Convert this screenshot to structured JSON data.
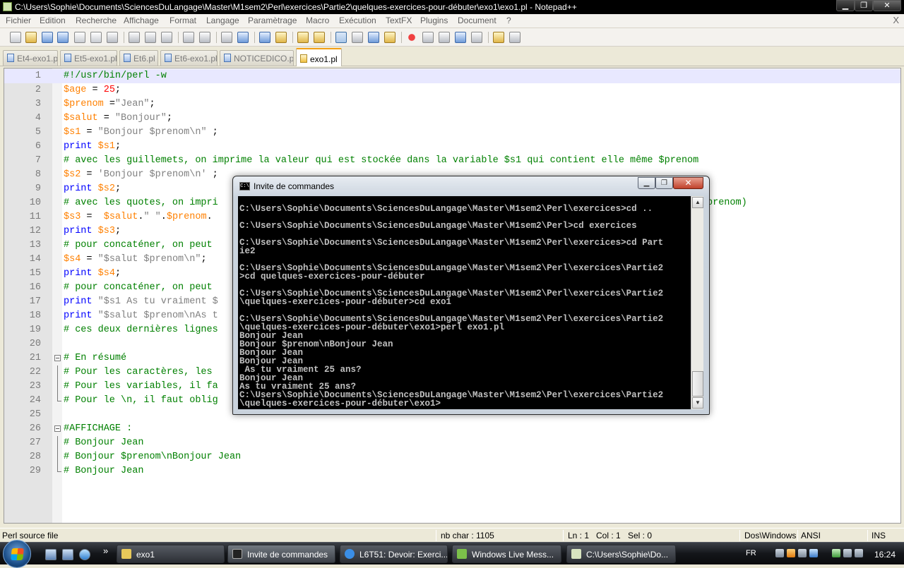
{
  "window": {
    "title": "C:\\Users\\Sophie\\Documents\\SciencesDuLangage\\Master\\M1sem2\\Perl\\exercices\\Partie2\\quelques-exercices-pour-débuter\\exo1\\exo1.pl - Notepad++",
    "minimize": "▁",
    "maximize": "❐",
    "close": "✕"
  },
  "menu": {
    "items": [
      "Fichier",
      "Edition",
      "Recherche",
      "Affichage",
      "Format",
      "Langage",
      "Paramètrage",
      "Macro",
      "Exécution",
      "TextFX",
      "Plugins",
      "Document",
      "?"
    ],
    "close_label": "X"
  },
  "tabs": [
    {
      "label": "Et4-exo1.pl",
      "active": false
    },
    {
      "label": "Et5-exo1.pl",
      "active": false
    },
    {
      "label": "Et6.pl",
      "active": false
    },
    {
      "label": "Et6-exo1.pl",
      "active": false
    },
    {
      "label": "NOTICEDICO.pl",
      "active": false
    },
    {
      "label": "exo1.pl",
      "active": true
    }
  ],
  "editor": {
    "current_line": 1,
    "lines": [
      {
        "n": "1",
        "tokens": [
          [
            "cm",
            "#!/usr/bin/perl -w"
          ]
        ]
      },
      {
        "n": "2",
        "tokens": [
          [
            "var",
            "$age"
          ],
          [
            "op",
            " = "
          ],
          [
            "num",
            "25"
          ],
          [
            "op",
            ";"
          ]
        ]
      },
      {
        "n": "3",
        "tokens": [
          [
            "var",
            "$prenom"
          ],
          [
            "op",
            " ="
          ],
          [
            "str",
            "\"Jean\""
          ],
          [
            "op",
            ";"
          ]
        ]
      },
      {
        "n": "4",
        "tokens": [
          [
            "var",
            "$salut"
          ],
          [
            "op",
            " = "
          ],
          [
            "str",
            "\"Bonjour\""
          ],
          [
            "op",
            ";"
          ]
        ]
      },
      {
        "n": "5",
        "tokens": [
          [
            "var",
            "$s1"
          ],
          [
            "op",
            " = "
          ],
          [
            "str",
            "\"Bonjour $prenom\\n\""
          ],
          [
            "op",
            " ;"
          ]
        ]
      },
      {
        "n": "6",
        "tokens": [
          [
            "kw",
            "print"
          ],
          [
            "op",
            " "
          ],
          [
            "var",
            "$s1"
          ],
          [
            "op",
            ";"
          ]
        ]
      },
      {
        "n": "7",
        "tokens": [
          [
            "cm",
            "# avec les guillemets, on imprime la valeur qui est stockée dans la variable $s1 qui contient elle même $prenom"
          ]
        ]
      },
      {
        "n": "8",
        "tokens": [
          [
            "var",
            "$s2"
          ],
          [
            "op",
            " = "
          ],
          [
            "str",
            "'Bonjour $prenom\\n'"
          ],
          [
            "op",
            " ;"
          ]
        ]
      },
      {
        "n": "9",
        "tokens": [
          [
            "kw",
            "print"
          ],
          [
            "op",
            " "
          ],
          [
            "var",
            "$s2"
          ],
          [
            "op",
            ";"
          ]
        ]
      },
      {
        "n": "10",
        "tokens": [
          [
            "cm",
            "# avec les quotes, on impri"
          ]
        ]
      },
      {
        "n": "11",
        "tokens": [
          [
            "var",
            "$s3"
          ],
          [
            "op",
            " =  "
          ],
          [
            "var",
            "$salut"
          ],
          [
            "op",
            "."
          ],
          [
            "str",
            "\" \""
          ],
          [
            "op",
            "."
          ],
          [
            "var",
            "$prenom"
          ],
          [
            "op",
            "."
          ]
        ]
      },
      {
        "n": "12",
        "tokens": [
          [
            "kw",
            "print"
          ],
          [
            "op",
            " "
          ],
          [
            "var",
            "$s3"
          ],
          [
            "op",
            ";"
          ]
        ]
      },
      {
        "n": "13",
        "tokens": [
          [
            "cm",
            "# pour concaténer, on peut "
          ]
        ]
      },
      {
        "n": "14",
        "tokens": [
          [
            "var",
            "$s4"
          ],
          [
            "op",
            " = "
          ],
          [
            "str",
            "\"$salut $prenom\\n\""
          ],
          [
            "op",
            ";"
          ]
        ]
      },
      {
        "n": "15",
        "tokens": [
          [
            "kw",
            "print"
          ],
          [
            "op",
            " "
          ],
          [
            "var",
            "$s4"
          ],
          [
            "op",
            ";"
          ]
        ]
      },
      {
        "n": "16",
        "tokens": [
          [
            "cm",
            "# pour concaténer, on peut "
          ]
        ]
      },
      {
        "n": "17",
        "tokens": [
          [
            "kw",
            "print"
          ],
          [
            "op",
            " "
          ],
          [
            "str",
            "\"$s1 As tu vraiment $"
          ]
        ]
      },
      {
        "n": "18",
        "tokens": [
          [
            "kw",
            "print"
          ],
          [
            "op",
            " "
          ],
          [
            "str",
            "\"$salut $prenom\\nAs t"
          ]
        ]
      },
      {
        "n": "19",
        "tokens": [
          [
            "cm",
            "# ces deux dernières lignes"
          ]
        ]
      },
      {
        "n": "20",
        "tokens": []
      },
      {
        "n": "21",
        "fold": "box",
        "tokens": [
          [
            "cm",
            "# En résumé"
          ]
        ]
      },
      {
        "n": "22",
        "fold": "line",
        "tokens": [
          [
            "cm",
            "# Pour les caractères, les "
          ]
        ]
      },
      {
        "n": "23",
        "fold": "line",
        "tokens": [
          [
            "cm",
            "# Pour les variables, il fa"
          ]
        ]
      },
      {
        "n": "24",
        "fold": "end",
        "tokens": [
          [
            "cm",
            "# Pour le \\n, il faut oblig"
          ]
        ]
      },
      {
        "n": "25",
        "tokens": []
      },
      {
        "n": "26",
        "fold": "box",
        "tokens": [
          [
            "cm",
            "#AFFICHAGE :"
          ]
        ]
      },
      {
        "n": "27",
        "fold": "line",
        "tokens": [
          [
            "cm",
            "# Bonjour Jean"
          ]
        ]
      },
      {
        "n": "28",
        "fold": "line",
        "tokens": [
          [
            "cm",
            "# Bonjour $prenom\\nBonjour Jean"
          ]
        ]
      },
      {
        "n": "29",
        "fold": "end",
        "tokens": [
          [
            "cm",
            "# Bonjour Jean"
          ]
        ]
      }
    ],
    "offscreen_right_of_line_10": "prenom)"
  },
  "cmd": {
    "title": "Invite de commandes",
    "icon_text": "C:\\",
    "lines": [
      "C:\\Users\\Sophie\\Documents\\SciencesDuLangage\\Master\\M1sem2\\Perl\\exercices>cd ..",
      "",
      "C:\\Users\\Sophie\\Documents\\SciencesDuLangage\\Master\\M1sem2\\Perl>cd exercices",
      "",
      "C:\\Users\\Sophie\\Documents\\SciencesDuLangage\\Master\\M1sem2\\Perl\\exercices>cd Part",
      "ie2",
      "",
      "C:\\Users\\Sophie\\Documents\\SciencesDuLangage\\Master\\M1sem2\\Perl\\exercices\\Partie2",
      ">cd quelques-exercices-pour-débuter",
      "",
      "C:\\Users\\Sophie\\Documents\\SciencesDuLangage\\Master\\M1sem2\\Perl\\exercices\\Partie2",
      "\\quelques-exercices-pour-débuter>cd exo1",
      "",
      "C:\\Users\\Sophie\\Documents\\SciencesDuLangage\\Master\\M1sem2\\Perl\\exercices\\Partie2",
      "\\quelques-exercices-pour-débuter\\exo1>perl exo1.pl",
      "Bonjour Jean",
      "Bonjour $prenom\\nBonjour Jean",
      "Bonjour Jean",
      "Bonjour Jean",
      " As tu vraiment 25 ans?",
      "Bonjour Jean",
      "As tu vraiment 25 ans?",
      "C:\\Users\\Sophie\\Documents\\SciencesDuLangage\\Master\\M1sem2\\Perl\\exercices\\Partie2",
      "\\quelques-exercices-pour-débuter\\exo1>"
    ],
    "scroll_up": "▲",
    "scroll_down": "▼"
  },
  "status": {
    "filetype": "Perl source file",
    "nbchar": "nb char : 1105",
    "ln": "Ln : 1",
    "col": "Col : 1",
    "sel": "Sel : 0",
    "eol": "Dos\\Windows",
    "encoding": "ANSI",
    "mode": "INS"
  },
  "taskbar": {
    "items": [
      {
        "label": "exo1",
        "icon_color": "#e8c95a",
        "active": false
      },
      {
        "label": "Invite de commandes",
        "icon_color": "#222222",
        "active": true
      },
      {
        "label": "L6T51: Devoir: Exerci...",
        "icon_color": "#3a8ee6",
        "active": false
      },
      {
        "label": "Windows Live Mess...",
        "icon_color": "#7cc04a",
        "active": false
      },
      {
        "label": "C:\\Users\\Sophie\\Do...",
        "icon_color": "#d8e4c0",
        "active": false
      }
    ],
    "chevron": "»",
    "lang": "FR",
    "clock": "16:24"
  }
}
